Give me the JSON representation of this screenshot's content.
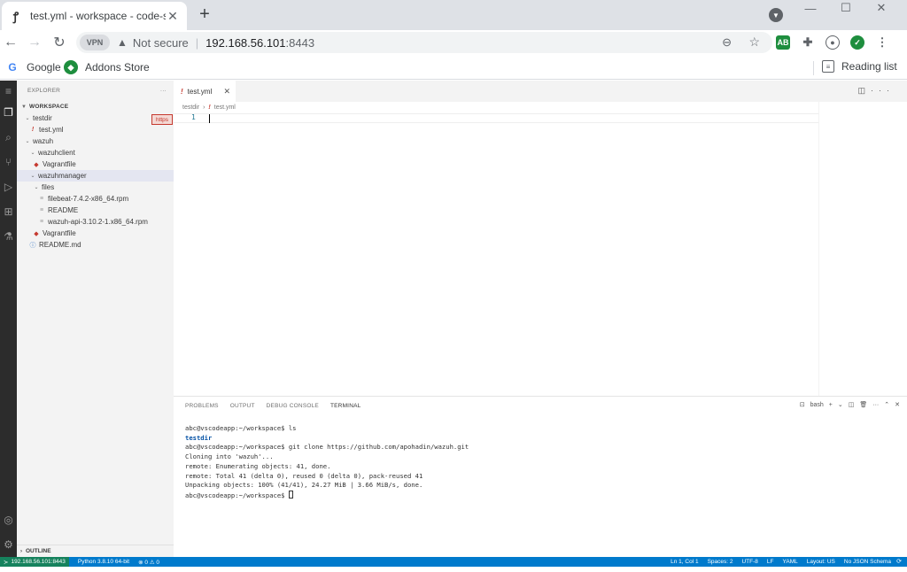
{
  "browser": {
    "tab_title": "test.yml - workspace - code-serv",
    "address": {
      "vpn_label": "VPN",
      "security_text": "Not secure",
      "host": "192.168.56.101",
      "port": ":8443"
    },
    "extensions": [
      "AB"
    ],
    "bookmarks": [
      {
        "label": "Google",
        "icon": "google-icon"
      },
      {
        "label": "Addons Store",
        "icon": "addons-store-icon"
      }
    ],
    "reading_list": "Reading list"
  },
  "explorer": {
    "title": "EXPLORER",
    "section": "WORKSPACE",
    "https_tag": "https",
    "outline": "OUTLINE",
    "items": [
      {
        "label": "testdir",
        "kind": "folder-open"
      },
      {
        "label": "test.yml",
        "kind": "yaml"
      },
      {
        "label": "wazuh",
        "kind": "folder-open"
      },
      {
        "label": "wazuhclient",
        "kind": "folder-open"
      },
      {
        "label": "Vagrantfile",
        "kind": "ruby"
      },
      {
        "label": "wazuhmanager",
        "kind": "folder-open"
      },
      {
        "label": "files",
        "kind": "folder-open"
      },
      {
        "label": "filebeat-7.4.2-x86_64.rpm",
        "kind": "file"
      },
      {
        "label": "README",
        "kind": "file"
      },
      {
        "label": "wazuh-api-3.10.2-1.x86_64.rpm",
        "kind": "file"
      },
      {
        "label": "Vagrantfile",
        "kind": "ruby"
      },
      {
        "label": "README.md",
        "kind": "info"
      }
    ]
  },
  "editor": {
    "tab_label": "test.yml",
    "breadcrumb": [
      "testdir",
      "test.yml"
    ],
    "line_number": "1"
  },
  "panel": {
    "tabs": [
      "PROBLEMS",
      "OUTPUT",
      "DEBUG CONSOLE",
      "TERMINAL"
    ],
    "shell": "bash",
    "terminal": {
      "line1": "abc@vscodeapp:~/workspace$ ls",
      "line2": "testdir",
      "line3": "abc@vscodeapp:~/workspace$ git clone https://github.com/apohadin/wazuh.git",
      "line4": "Cloning into 'wazuh'...",
      "line5": "remote: Enumerating objects: 41, done.",
      "line6": "remote: Total 41 (delta 0), reused 0 (delta 0), pack-reused 41",
      "line7": "Unpacking objects: 100% (41/41), 24.27 MiB | 3.66 MiB/s, done.",
      "line8": "abc@vscodeapp:~/workspace$ "
    }
  },
  "statusbar": {
    "remote": "192.168.56.101:8443",
    "python": "Python 3.8.10 64-bit",
    "problems": "⊗ 0 ⚠ 0",
    "position": "Ln 1, Col 1",
    "spaces": "Spaces: 2",
    "encoding": "UTF-8",
    "eol": "LF",
    "language": "YAML",
    "layout": "Layout: US",
    "schema": "No JSON Schema"
  }
}
